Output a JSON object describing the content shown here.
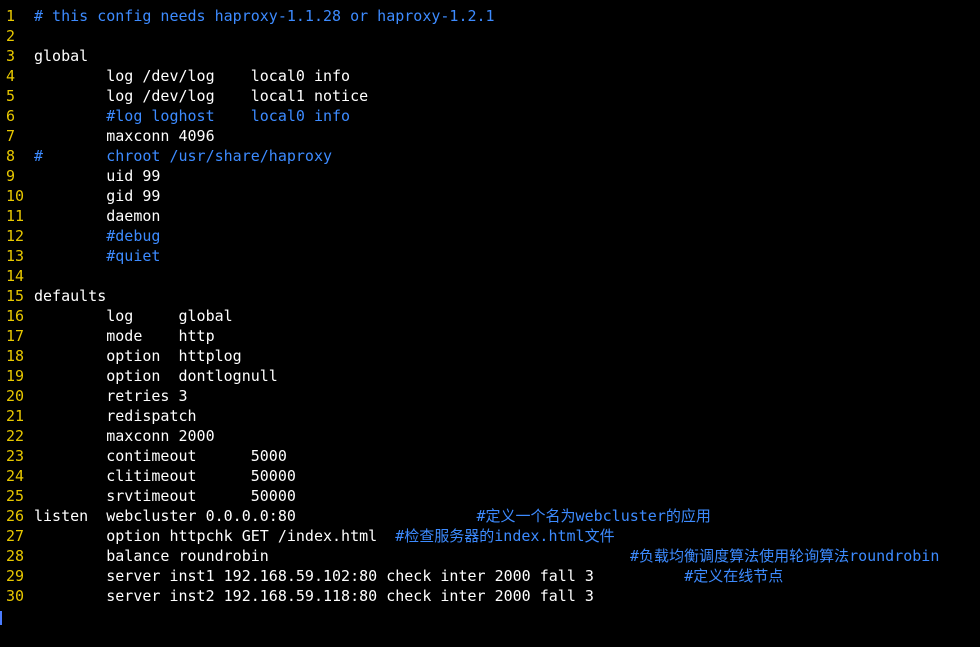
{
  "colors": {
    "background": "#000000",
    "text": "#ffffff",
    "line_number": "#e8c800",
    "comment": "#3d8bff"
  },
  "lines": [
    {
      "n": "1",
      "segs": [
        {
          "t": "# this config needs haproxy-1.1.28 or haproxy-1.2.1",
          "c": "c"
        }
      ]
    },
    {
      "n": "2",
      "segs": []
    },
    {
      "n": "3",
      "segs": [
        {
          "t": "global",
          "c": "n"
        }
      ]
    },
    {
      "n": "4",
      "segs": [
        {
          "t": "        log /dev/log    local0 info",
          "c": "n"
        }
      ]
    },
    {
      "n": "5",
      "segs": [
        {
          "t": "        log /dev/log    local1 notice",
          "c": "n"
        }
      ]
    },
    {
      "n": "6",
      "segs": [
        {
          "t": "        #log loghost    local0 info",
          "c": "c"
        }
      ]
    },
    {
      "n": "7",
      "segs": [
        {
          "t": "        maxconn 4096",
          "c": "n"
        }
      ]
    },
    {
      "n": "8",
      "segs": [
        {
          "t": "#       chroot /usr/share/haproxy",
          "c": "c"
        }
      ]
    },
    {
      "n": "9",
      "segs": [
        {
          "t": "        uid 99",
          "c": "n"
        }
      ]
    },
    {
      "n": "10",
      "segs": [
        {
          "t": "        gid 99",
          "c": "n"
        }
      ]
    },
    {
      "n": "11",
      "segs": [
        {
          "t": "        daemon",
          "c": "n"
        }
      ]
    },
    {
      "n": "12",
      "segs": [
        {
          "t": "        #debug",
          "c": "c"
        }
      ]
    },
    {
      "n": "13",
      "segs": [
        {
          "t": "        #quiet",
          "c": "c"
        }
      ]
    },
    {
      "n": "14",
      "segs": []
    },
    {
      "n": "15",
      "segs": [
        {
          "t": "defaults",
          "c": "n"
        }
      ]
    },
    {
      "n": "16",
      "segs": [
        {
          "t": "        log     global",
          "c": "n"
        }
      ]
    },
    {
      "n": "17",
      "segs": [
        {
          "t": "        mode    http",
          "c": "n"
        }
      ]
    },
    {
      "n": "18",
      "segs": [
        {
          "t": "        option  httplog",
          "c": "n"
        }
      ]
    },
    {
      "n": "19",
      "segs": [
        {
          "t": "        option  dontlognull",
          "c": "n"
        }
      ]
    },
    {
      "n": "20",
      "segs": [
        {
          "t": "        retries 3",
          "c": "n"
        }
      ]
    },
    {
      "n": "21",
      "segs": [
        {
          "t": "        redispatch",
          "c": "n"
        }
      ]
    },
    {
      "n": "22",
      "segs": [
        {
          "t": "        maxconn 2000",
          "c": "n"
        }
      ]
    },
    {
      "n": "23",
      "segs": [
        {
          "t": "        contimeout      5000",
          "c": "n"
        }
      ]
    },
    {
      "n": "24",
      "segs": [
        {
          "t": "        clitimeout      50000",
          "c": "n"
        }
      ]
    },
    {
      "n": "25",
      "segs": [
        {
          "t": "        srvtimeout      50000",
          "c": "n"
        }
      ]
    },
    {
      "n": "26",
      "segs": [
        {
          "t": "listen  webcluster 0.0.0.0:80                    ",
          "c": "n"
        },
        {
          "t": "#定义一个名为webcluster的应用",
          "c": "c"
        }
      ]
    },
    {
      "n": "27",
      "segs": [
        {
          "t": "        option httpchk GET /index.html  ",
          "c": "n"
        },
        {
          "t": "#检查服务器的index.html文件",
          "c": "c"
        }
      ]
    },
    {
      "n": "28",
      "segs": [
        {
          "t": "        balance roundrobin                                        ",
          "c": "n"
        },
        {
          "t": "#负载均衡调度算法使用轮询算法roundrobin",
          "c": "c"
        }
      ]
    },
    {
      "n": "29",
      "segs": [
        {
          "t": "        server inst1 192.168.59.102:80 check inter 2000 fall 3          ",
          "c": "n"
        },
        {
          "t": "#定义在线节点",
          "c": "c"
        }
      ]
    },
    {
      "n": "30",
      "segs": [
        {
          "t": "        server inst2 192.168.59.118:80 check inter 2000 fall 3",
          "c": "n"
        }
      ]
    }
  ]
}
